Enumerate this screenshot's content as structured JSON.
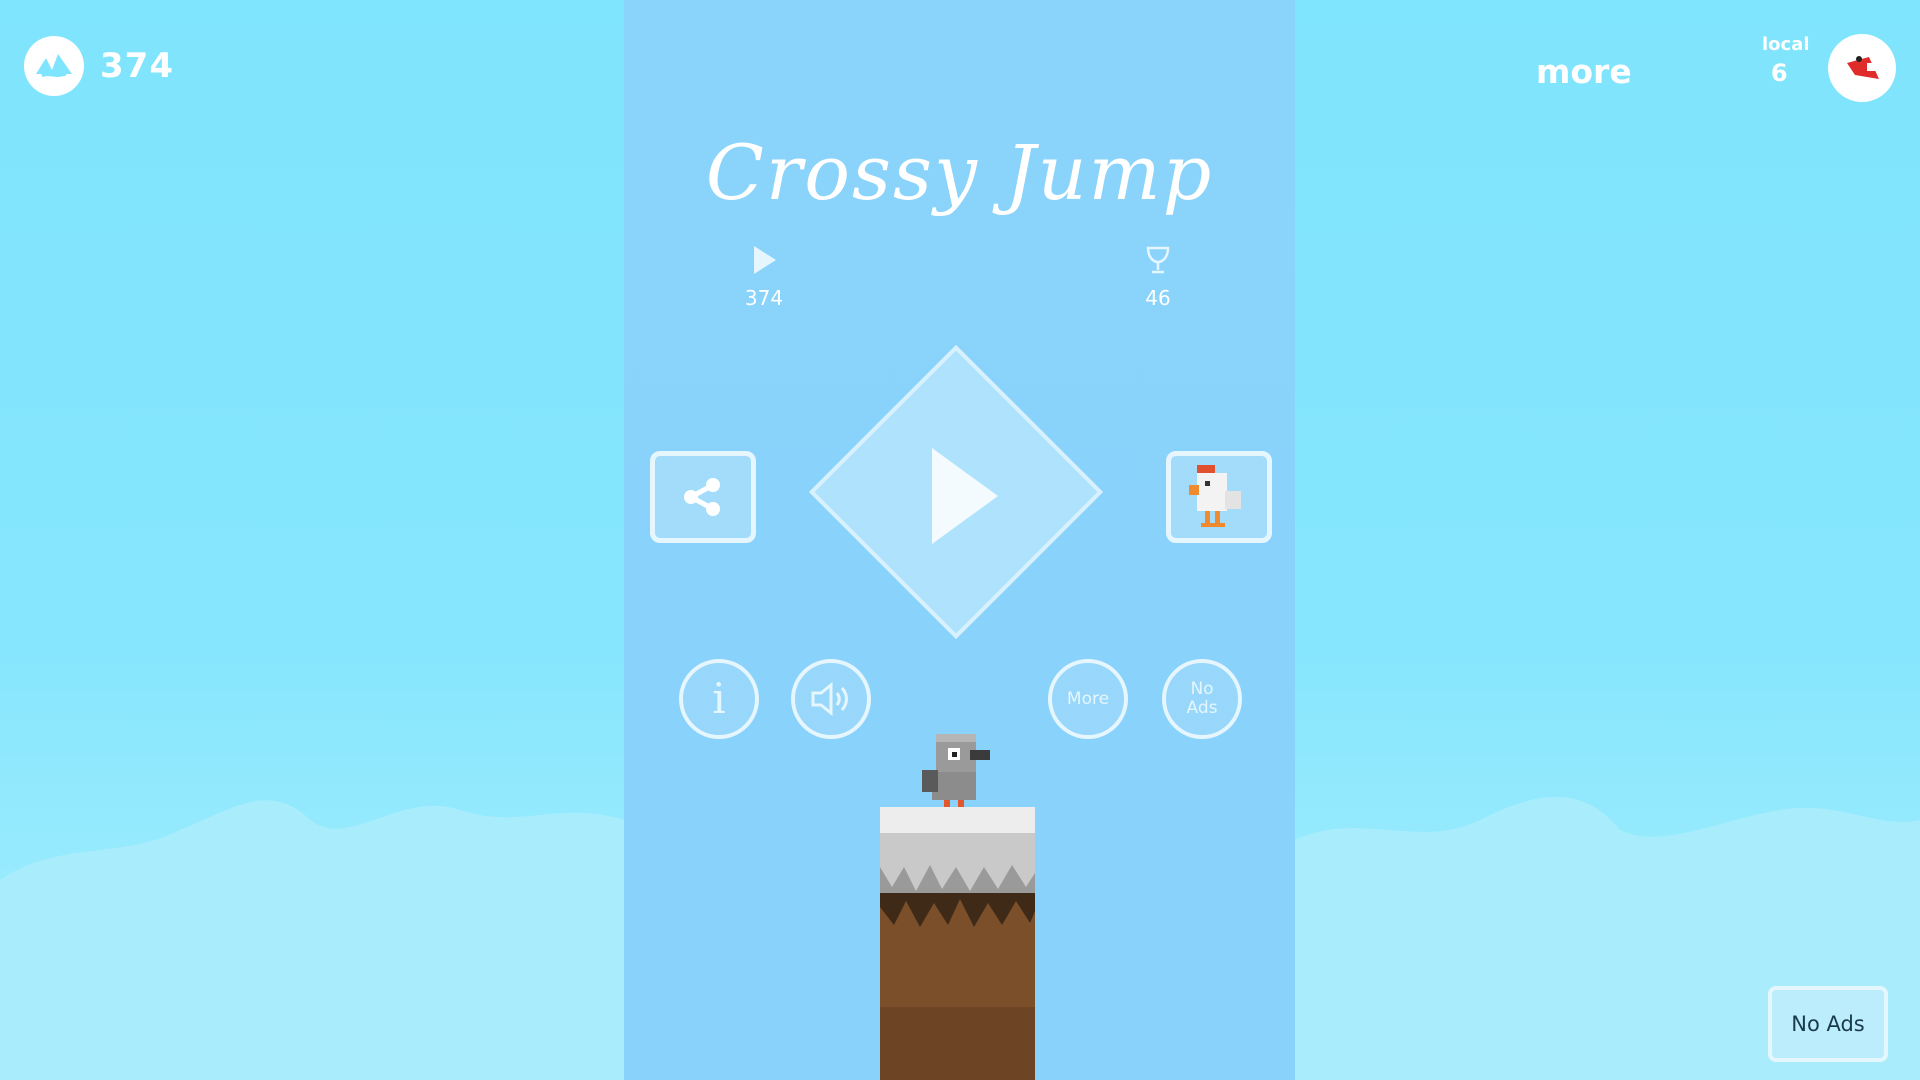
{
  "top_left": {
    "icon": "mountain-logo-icon",
    "count": "374"
  },
  "top_right": {
    "more_label": "more",
    "rank_label": "local",
    "rank_value": "6"
  },
  "title": "Crossy Jump",
  "stats": {
    "played": "374",
    "best": "46"
  },
  "buttons": {
    "share": "share-icon",
    "character": "chicken-icon",
    "info_label": "i",
    "sound": "speaker-icon",
    "more_label": "More",
    "noads_label": "No Ads"
  },
  "corner_noads_label": "No Ads",
  "colors": {
    "sky": "#86e6fd",
    "panel": "#88d2fb",
    "dirt": "#7a4f2a",
    "stone": "#c9c9c9"
  }
}
